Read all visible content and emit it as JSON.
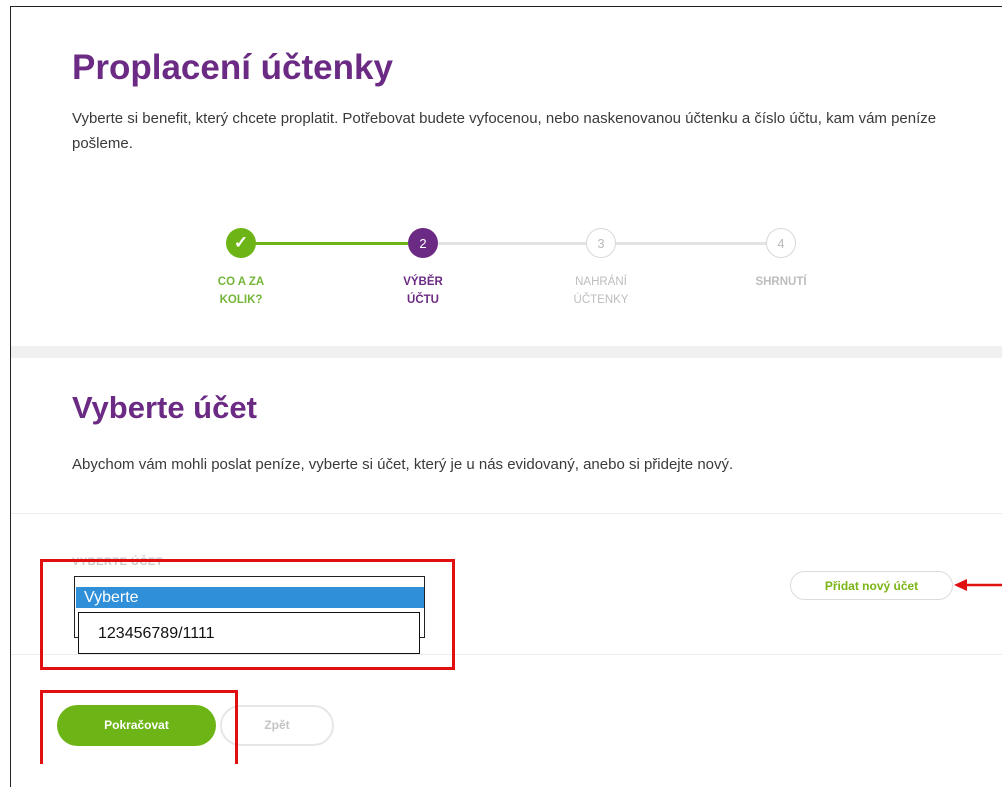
{
  "header": {
    "title": "Proplacení účtenky",
    "intro": "Vyberte si benefit, který chcete proplatit. Potřebovat budete vyfocenou, nebo naskenovanou účtenku a číslo účtu, kam vám peníze pošleme."
  },
  "steps": [
    {
      "marker": "✓",
      "line1": "CO A ZA",
      "line2": "KOLIK?",
      "state": "done"
    },
    {
      "marker": "2",
      "line1": "VÝBĚR",
      "line2": "ÚČTU",
      "state": "active"
    },
    {
      "marker": "3",
      "line1": "NAHRÁNÍ",
      "line2": "ÚČTENKY",
      "state": "pending"
    },
    {
      "marker": "4",
      "line1": "SHRNUTÍ",
      "line2": "",
      "state": "pending"
    }
  ],
  "account": {
    "title": "Vyberte účet",
    "description": "Abychom vám mohli poslat peníze, vyberte si účet, který je u nás evidovaný, anebo si přidejte nový.",
    "field_label": "VYBERTE ÚČET",
    "selected_option": "Vyberte",
    "options": [
      "123456789/1111"
    ],
    "add_button": "Přidat nový účet"
  },
  "actions": {
    "continue": "Pokračovat",
    "back": "Zpět"
  },
  "colors": {
    "brand_purple": "#6b2a83",
    "brand_green": "#6db516",
    "annotation_red": "#e01010"
  }
}
